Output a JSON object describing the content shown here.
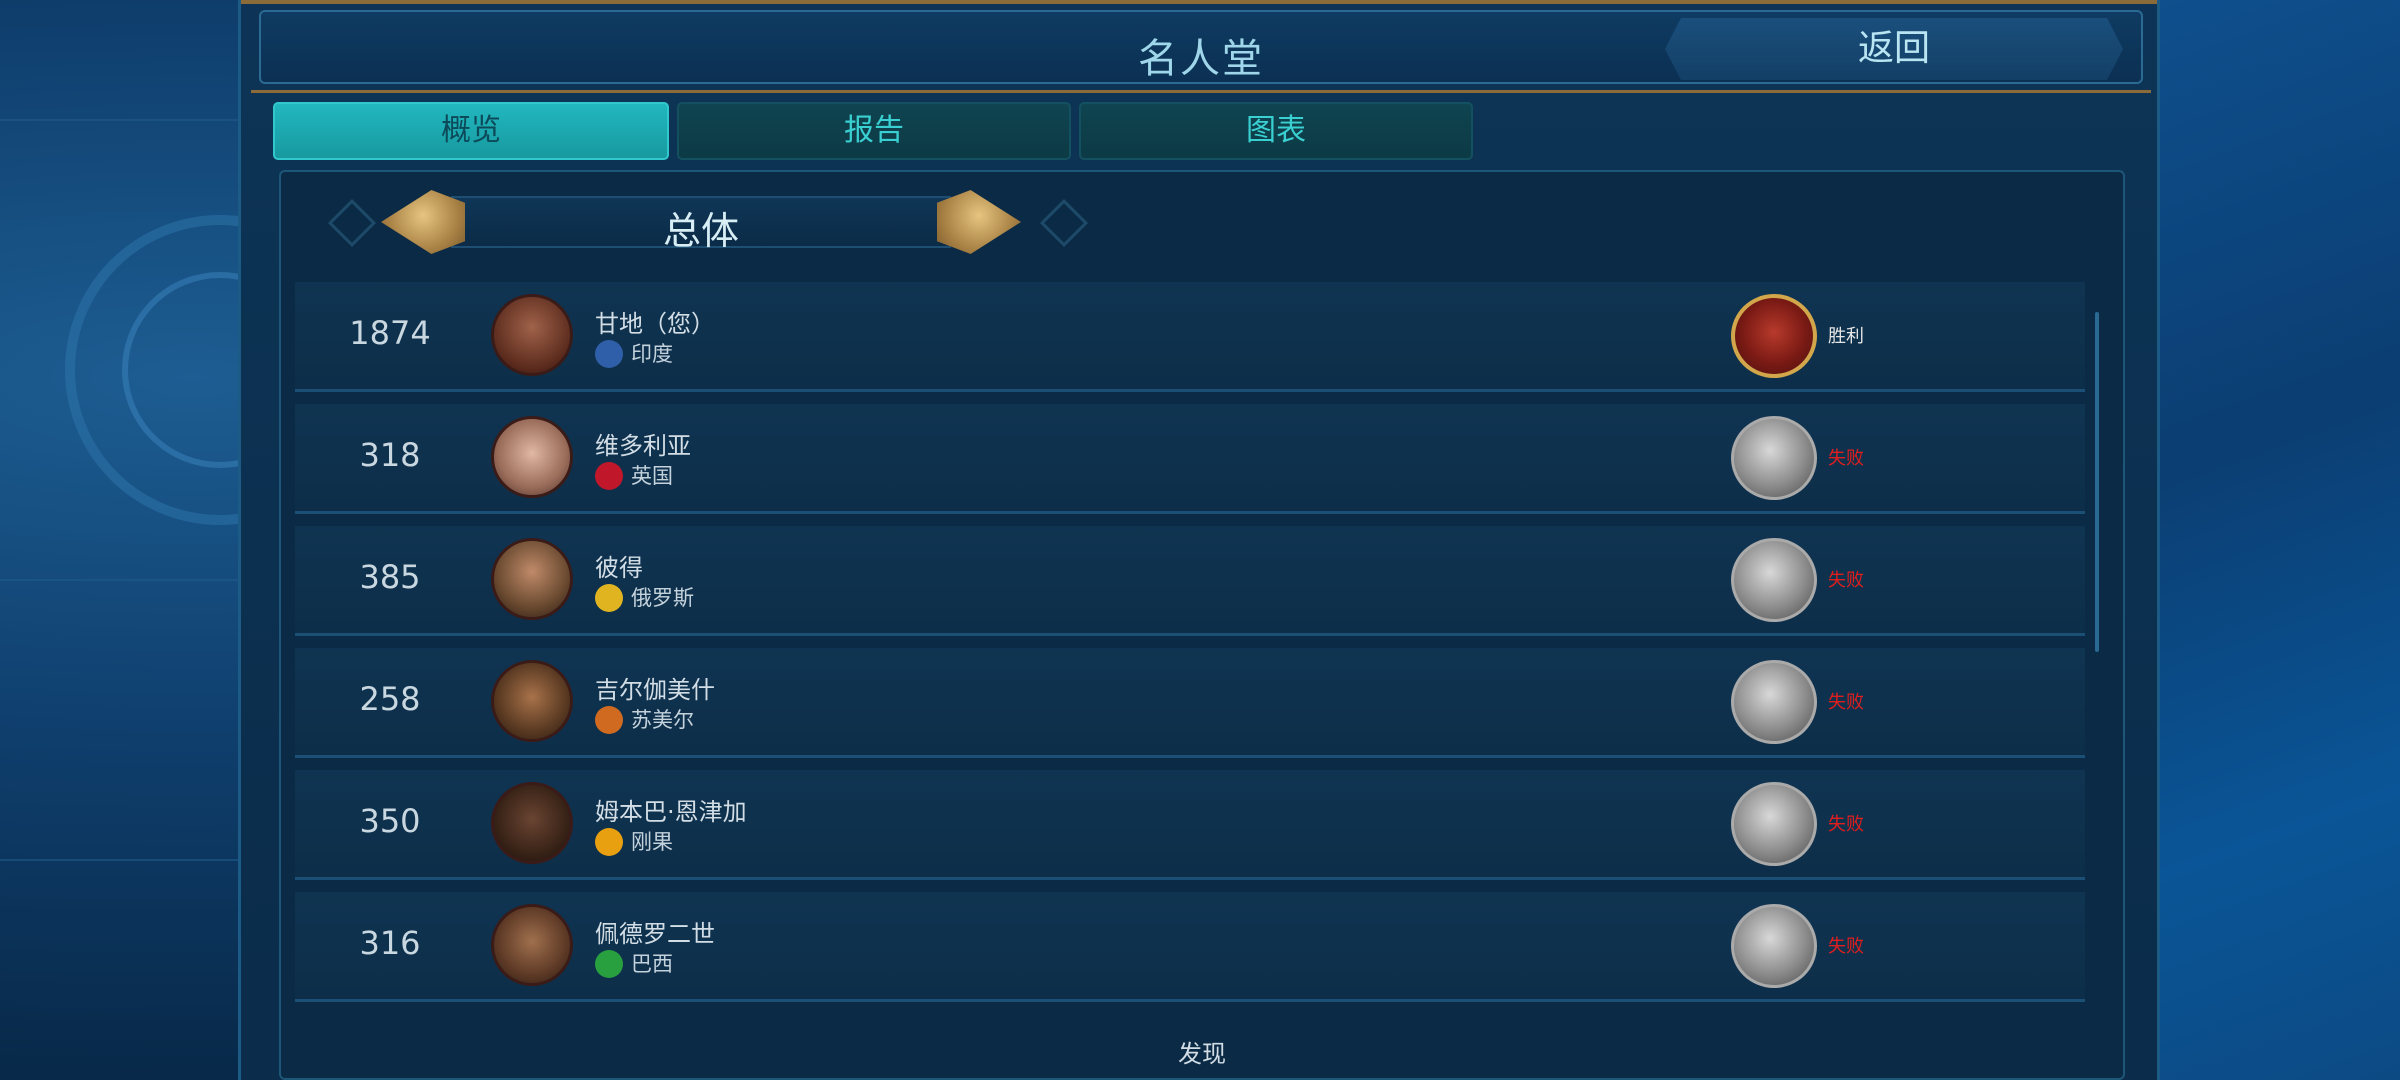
{
  "header": {
    "title": "名人堂",
    "back_label": "返回"
  },
  "tabs": [
    {
      "label": "概览",
      "active": true
    },
    {
      "label": "报告",
      "active": false
    },
    {
      "label": "图表",
      "active": false
    }
  ],
  "selector": {
    "label": "总体"
  },
  "rows": [
    {
      "score": "1874",
      "leader": "甘地（您）",
      "civ": "印度",
      "result": "胜利",
      "outcome": "win",
      "civ_color": "#2f5fa8",
      "portrait_color": "#7a3d2a"
    },
    {
      "score": "318",
      "leader": "维多利亚",
      "civ": "英国",
      "result": "失败",
      "outcome": "lose",
      "civ_color": "#c0182a",
      "portrait_color": "#b08a78"
    },
    {
      "score": "385",
      "leader": "彼得",
      "civ": "俄罗斯",
      "result": "失败",
      "outcome": "lose",
      "civ_color": "#e0b420",
      "portrait_color": "#6a4a30"
    },
    {
      "score": "258",
      "leader": "吉尔伽美什",
      "civ": "苏美尔",
      "result": "失败",
      "outcome": "lose",
      "civ_color": "#d06a20",
      "portrait_color": "#5a3a22"
    },
    {
      "score": "350",
      "leader": "姆本巴·恩津加",
      "civ": "刚果",
      "result": "失败",
      "outcome": "lose",
      "civ_color": "#e8a010",
      "portrait_color": "#3a2418"
    },
    {
      "score": "316",
      "leader": "佩德罗二世",
      "civ": "巴西",
      "result": "失败",
      "outcome": "lose",
      "civ_color": "#28a040",
      "portrait_color": "#5e3a26"
    }
  ],
  "footer": {
    "text": "发现"
  }
}
